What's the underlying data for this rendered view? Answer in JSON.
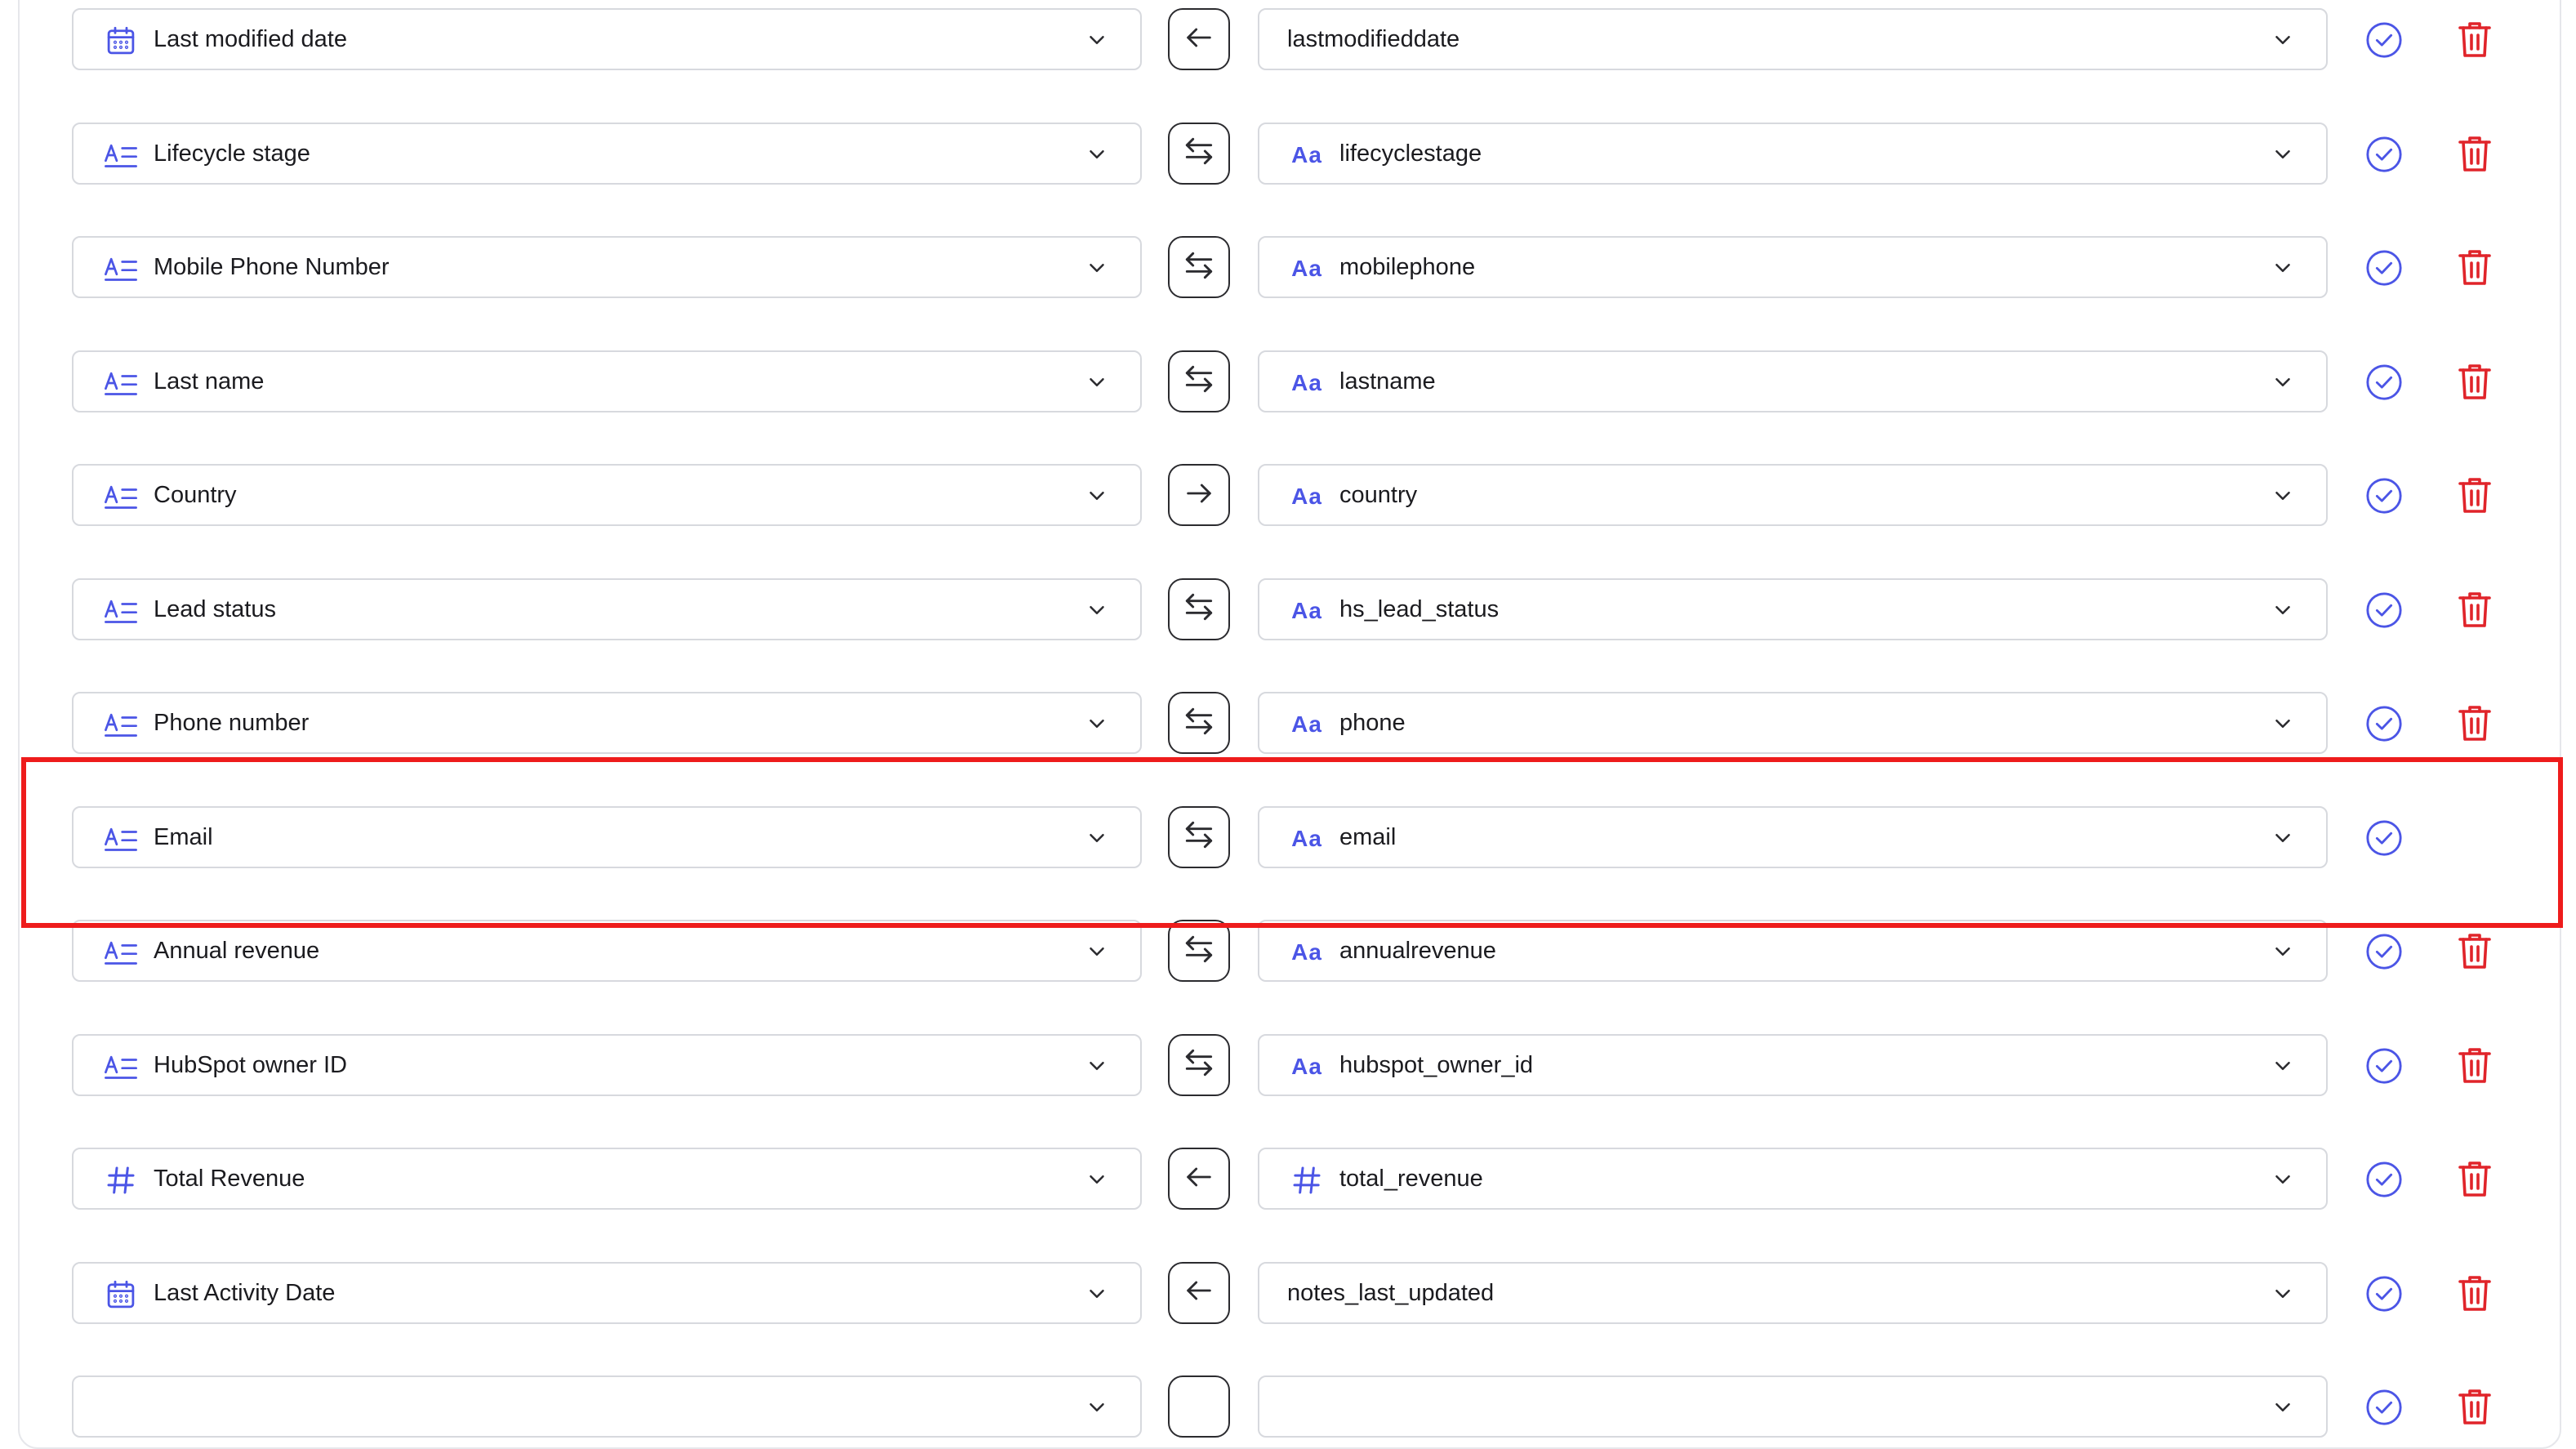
{
  "colors": {
    "accent": "#4b55e6",
    "delete": "#e0242a",
    "highlight": "#ee1c1c",
    "border": "#d7d9de"
  },
  "rows": [
    {
      "source": "Last modified date",
      "source_icon": "calendar-icon",
      "direction": "left-arrow-icon",
      "target": "lastmodifieddate",
      "target_icon": "",
      "deletable": true
    },
    {
      "source": "Lifecycle stage",
      "source_icon": "text-field-icon",
      "direction": "bidirectional-arrow-icon",
      "target": "lifecyclestage",
      "target_icon": "text-type-icon",
      "deletable": true
    },
    {
      "source": "Mobile Phone Number",
      "source_icon": "text-field-icon",
      "direction": "bidirectional-arrow-icon",
      "target": "mobilephone",
      "target_icon": "text-type-icon",
      "deletable": true
    },
    {
      "source": "Last name",
      "source_icon": "text-field-icon",
      "direction": "bidirectional-arrow-icon",
      "target": "lastname",
      "target_icon": "text-type-icon",
      "deletable": true
    },
    {
      "source": "Country",
      "source_icon": "text-field-icon",
      "direction": "right-arrow-icon",
      "target": "country",
      "target_icon": "text-type-icon",
      "deletable": true
    },
    {
      "source": "Lead status",
      "source_icon": "text-field-icon",
      "direction": "bidirectional-arrow-icon",
      "target": "hs_lead_status",
      "target_icon": "text-type-icon",
      "deletable": true
    },
    {
      "source": "Phone number",
      "source_icon": "text-field-icon",
      "direction": "bidirectional-arrow-icon",
      "target": "phone",
      "target_icon": "text-type-icon",
      "deletable": true
    },
    {
      "source": "Email",
      "source_icon": "text-field-icon",
      "direction": "bidirectional-arrow-icon",
      "target": "email",
      "target_icon": "text-type-icon",
      "deletable": false
    },
    {
      "source": "Annual revenue",
      "source_icon": "text-field-icon",
      "direction": "bidirectional-arrow-icon",
      "target": "annualrevenue",
      "target_icon": "text-type-icon",
      "deletable": true
    },
    {
      "source": "HubSpot owner ID",
      "source_icon": "text-field-icon",
      "direction": "bidirectional-arrow-icon",
      "target": "hubspot_owner_id",
      "target_icon": "text-type-icon",
      "deletable": true
    },
    {
      "source": "Total Revenue",
      "source_icon": "number-icon",
      "direction": "left-arrow-icon",
      "target": "total_revenue",
      "target_icon": "number-icon",
      "deletable": true
    },
    {
      "source": "Last Activity Date",
      "source_icon": "calendar-icon",
      "direction": "left-arrow-icon",
      "target": "notes_last_updated",
      "target_icon": "",
      "deletable": true
    },
    {
      "source": "",
      "source_icon": "",
      "direction": "",
      "target": "",
      "target_icon": "",
      "deletable": true
    }
  ],
  "highlighted_row": 7
}
